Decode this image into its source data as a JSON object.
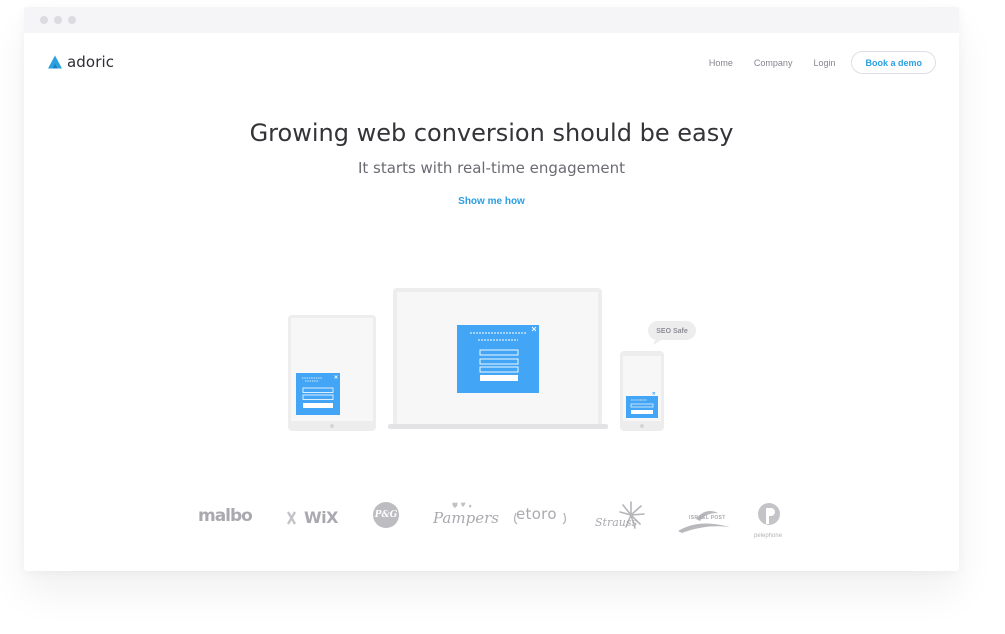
{
  "logo": {
    "text": "adoric",
    "icon": "adoric-triangle-icon",
    "color": "#2a9fe2"
  },
  "nav": {
    "items": [
      {
        "label": "Home"
      },
      {
        "label": "Company"
      },
      {
        "label": "Login"
      }
    ],
    "cta_label": "Book a demo"
  },
  "hero": {
    "title": "Growing web conversion should be easy",
    "subtitle": "It starts with real-time engagement",
    "cta": "Show me how"
  },
  "illustration": {
    "badge": "SEO Safe",
    "popup_color": "#42a5f5",
    "device_color": "#eeeeef",
    "close_icon": "close-icon"
  },
  "clients": {
    "logos": [
      {
        "name": "malbo",
        "text": "malbo"
      },
      {
        "name": "wix",
        "text": "WiX"
      },
      {
        "name": "pg",
        "text": "P&G"
      },
      {
        "name": "pampers",
        "text": "Pampers"
      },
      {
        "name": "etoro",
        "text": "etoro"
      },
      {
        "name": "strauss",
        "text": "Strauss"
      },
      {
        "name": "israel-post",
        "text": "ISRAEL POST"
      },
      {
        "name": "pelephone",
        "text": "pelephone"
      }
    ]
  },
  "colors": {
    "accent": "#2a9fe2",
    "title": "#333338",
    "muted": "#858590",
    "logo_gray": "#a9a9af"
  }
}
